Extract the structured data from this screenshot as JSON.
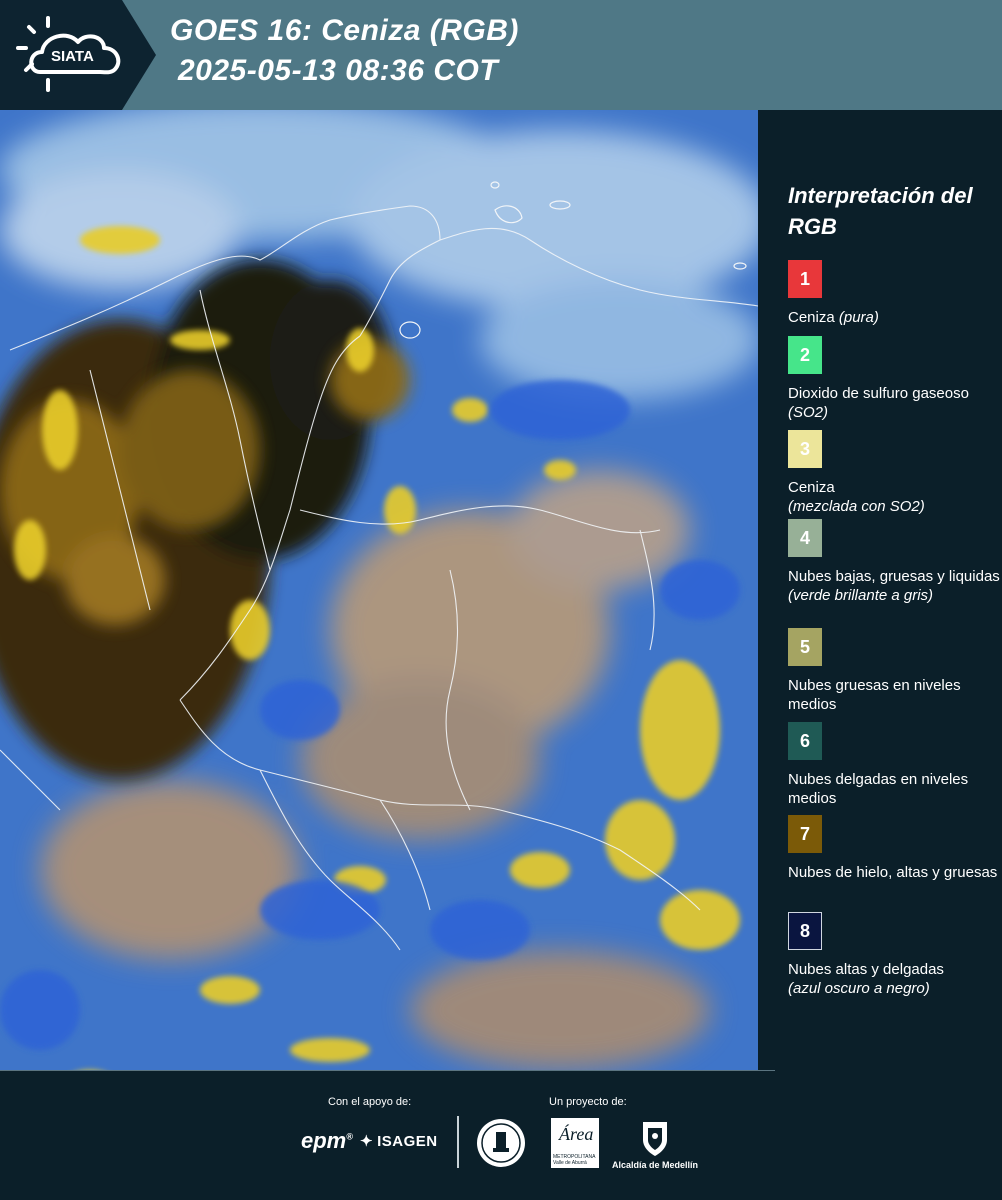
{
  "header": {
    "logo_text": "SIATA",
    "title_line1": "GOES 16: Ceniza (RGB)",
    "title_line2": "2025-05-13 08:36 COT"
  },
  "legend": {
    "title": "Interpretación del RGB",
    "items": [
      {
        "num": "1",
        "color": "#e8373a",
        "label": "Ceniza ",
        "note": "(pura)"
      },
      {
        "num": "2",
        "color": "#46e58a",
        "label": "Dioxido de sulfuro gaseoso ",
        "note": "(SO2)"
      },
      {
        "num": "3",
        "color": "#ece59a",
        "label": "Ceniza ",
        "note": "(mezclada con SO2)"
      },
      {
        "num": "4",
        "color": "#97b097",
        "label": "Nubes bajas, gruesas y liquidas ",
        "note": "(verde brillante a gris)"
      },
      {
        "num": "5",
        "color": "#a5a462",
        "label": "Nubes gruesas en niveles medios",
        "note": ""
      },
      {
        "num": "6",
        "color": "#1f5a55",
        "label": "Nubes delgadas en niveles medios",
        "note": ""
      },
      {
        "num": "7",
        "color": "#7b5a08",
        "label": "Nubes de hielo, altas y gruesas",
        "note": ""
      },
      {
        "num": "8",
        "color": "#0a1540",
        "label": "Nubes altas y delgadas ",
        "note": "(azul oscuro a negro)"
      }
    ]
  },
  "footer": {
    "support_caption": "Con el apoyo de:",
    "project_caption": "Un proyecto de:",
    "sponsor_1": "epm",
    "sponsor_2": "ISAGEN",
    "partner_area": "Área",
    "partner_area_sub1": "METROPOLITANA",
    "partner_area_sub2": "Valle de Aburrá",
    "partner_city": "Alcaldía de Medellín"
  }
}
